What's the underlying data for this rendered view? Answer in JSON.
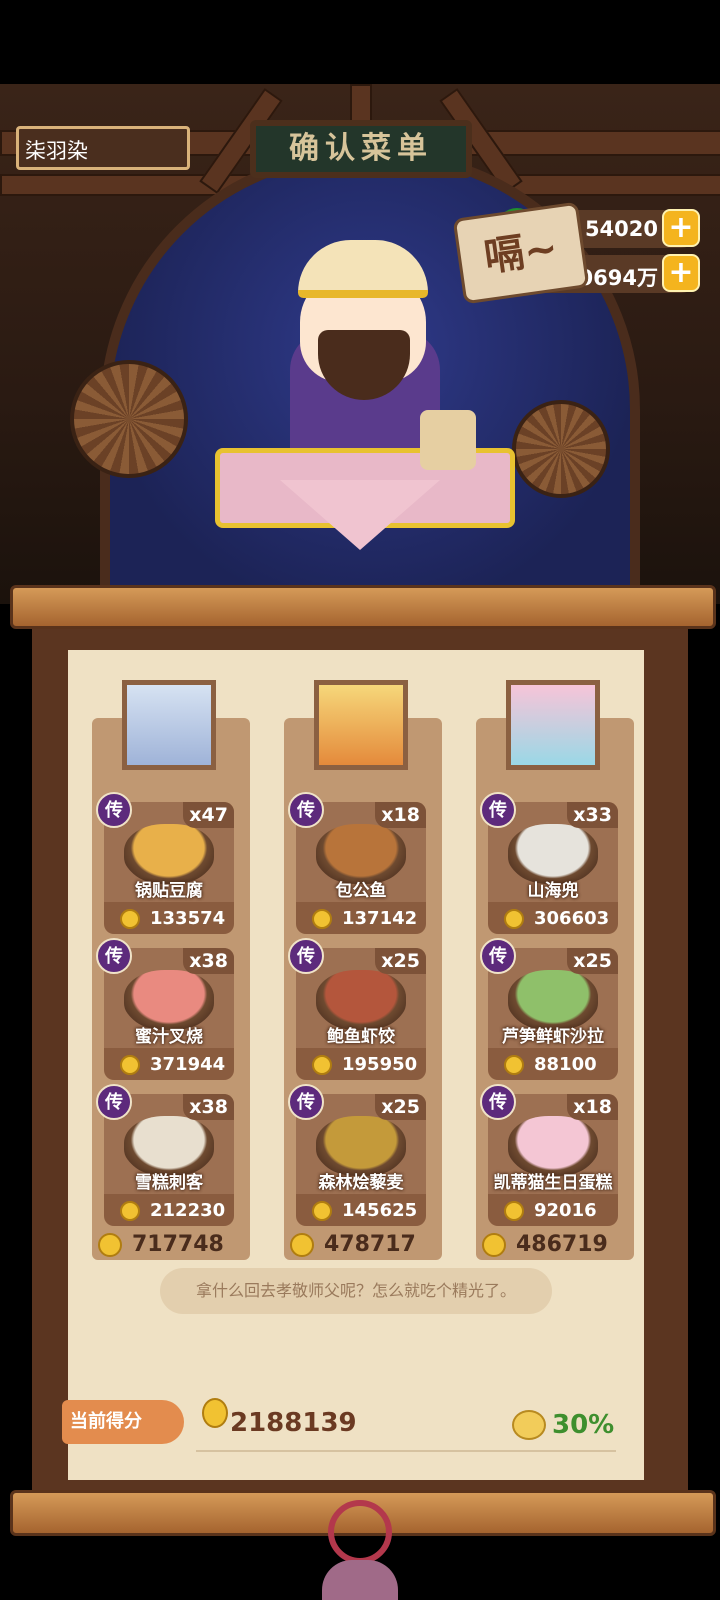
{
  "header": {
    "player_name": "柒羽染",
    "sign": "确认菜单",
    "speech": "嗝~",
    "jade_amount": "54020",
    "coin_amount": "90694万"
  },
  "badge_label": "传",
  "columns": [
    {
      "items": [
        {
          "name": "锅贴豆腐",
          "qty": "x47",
          "price": "133574",
          "color": "#e8b04a"
        },
        {
          "name": "蜜汁叉烧",
          "qty": "x38",
          "price": "371944",
          "color": "#e98a80"
        },
        {
          "name": "雪糕刺客",
          "qty": "x38",
          "price": "212230",
          "color": "#e8dfcf"
        }
      ],
      "total": "717748"
    },
    {
      "items": [
        {
          "name": "包公鱼",
          "qty": "x18",
          "price": "137142",
          "color": "#b8743a"
        },
        {
          "name": "鲍鱼虾饺",
          "qty": "x25",
          "price": "195950",
          "color": "#b4563c"
        },
        {
          "name": "森林烩藜麦",
          "qty": "x25",
          "price": "145625",
          "color": "#c49a3a"
        }
      ],
      "total": "478717"
    },
    {
      "items": [
        {
          "name": "山海兜",
          "qty": "x33",
          "price": "306603",
          "color": "#e6e3dc"
        },
        {
          "name": "芦笋鲜虾沙拉",
          "qty": "x25",
          "price": "88100",
          "color": "#8fc06a"
        },
        {
          "name": "凯蒂猫生日蛋糕",
          "qty": "x18",
          "price": "92016",
          "color": "#f4c6d4"
        }
      ],
      "total": "486719"
    }
  ],
  "quote": "拿什么回去孝敬师父呢？怎么就吃个精光了。",
  "score": {
    "label": "当前得分",
    "value": "2188139",
    "percent": "30%"
  }
}
